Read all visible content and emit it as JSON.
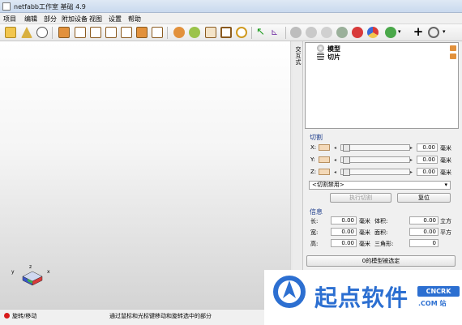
{
  "window": {
    "title": "netfabb工作室 基础 4.9"
  },
  "menu": [
    "项目",
    "编辑",
    "部分",
    "附加设备",
    "视图",
    "设置",
    "帮助"
  ],
  "side_tab": {
    "label": "交互式"
  },
  "tree": [
    {
      "label": "模型",
      "icon": "model-icon"
    },
    {
      "label": "切片",
      "icon": "slice-icon"
    }
  ],
  "cut": {
    "title": "切割",
    "rows": [
      {
        "axis": "X:",
        "value": "0.00",
        "unit": "毫米"
      },
      {
        "axis": "Y:",
        "value": "0.00",
        "unit": "毫米"
      },
      {
        "axis": "Z:",
        "value": "0.00",
        "unit": "毫米"
      }
    ],
    "mode_select": "<切割禁用>",
    "execute_label": "执行切割",
    "reset_label": "复位"
  },
  "info": {
    "title": "信息",
    "length_label": "长:",
    "length_value": "0.00",
    "length_unit": "毫米",
    "width_label": "宽:",
    "width_value": "0.00",
    "width_unit": "毫米",
    "height_label": "高:",
    "height_value": "0.00",
    "height_unit": "毫米",
    "volume_label": "体积:",
    "volume_value": "0.00",
    "volume_unit": "立方",
    "area_label": "面积:",
    "area_value": "0.00",
    "area_unit": "平方",
    "triangles_label": "三角形:",
    "triangles_value": "0"
  },
  "selection_button": "0的模型被选定",
  "status": {
    "mode": "旋转/移动",
    "hint": "通过鼠标和光标键移动和旋转选中的部分"
  },
  "watermark": {
    "name": "起点软件",
    "badge": "CNCRK",
    "sub": ".COM 站"
  }
}
